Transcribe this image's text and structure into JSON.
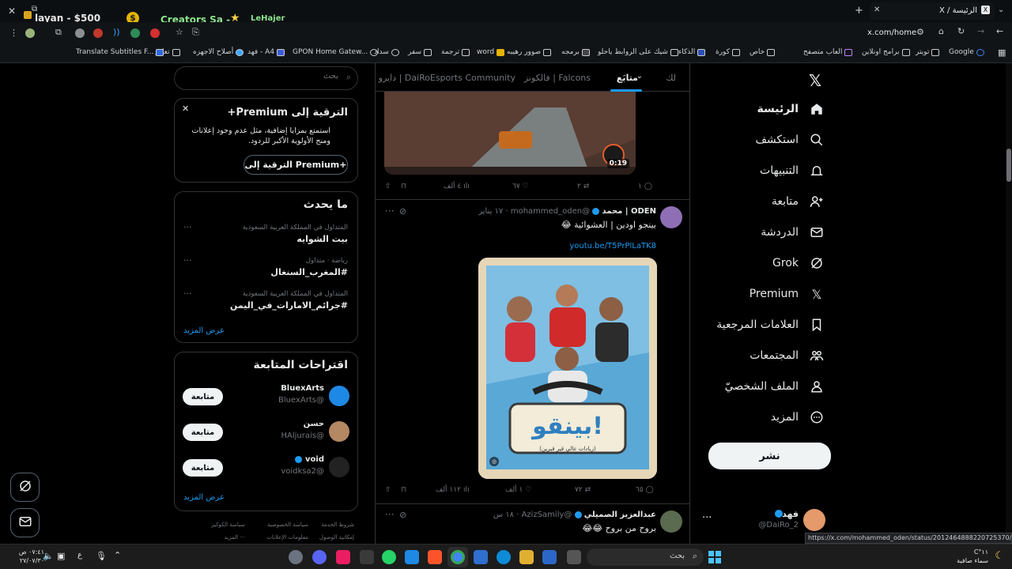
{
  "browser": {
    "tab_title": "الرئيسة / X",
    "tab_left_texts": [
      "layan - $500",
      "Creators Sa -",
      "LeHajer"
    ],
    "url": "x.com/home",
    "bookmarks": [
      "Google",
      "تويتر",
      "برامج اونلاين",
      "العاب متصفح",
      "خاص",
      "كورة",
      "الذكاء",
      "شيك على الروابط ياحلو",
      "برمجه",
      "صوور رهيبه",
      "word",
      "ترجمة",
      "سفر",
      "سداد",
      "GPON Home Gatew...",
      "فهد - A4",
      "أصلاح الاجهزه",
      "تعليم",
      "Translate Subtitles F..."
    ],
    "status_url": "https://x.com/mohammed_oden/status/2012464888220725370/photo/1"
  },
  "nav": {
    "items": [
      {
        "label": "الرئيسة",
        "icon": "home-icon"
      },
      {
        "label": "استكشف",
        "icon": "search-icon"
      },
      {
        "label": "التنبيهات",
        "icon": "bell-icon"
      },
      {
        "label": "متابعة",
        "icon": "add-user-icon"
      },
      {
        "label": "الدردشة",
        "icon": "mail-icon"
      },
      {
        "label": "Grok",
        "icon": "grok-icon"
      },
      {
        "label": "Premium",
        "icon": "x-icon"
      },
      {
        "label": "العلامات المرجعية",
        "icon": "bookmark-icon"
      },
      {
        "label": "المجتمعات",
        "icon": "communities-icon"
      },
      {
        "label": "الملف الشخصيّ",
        "icon": "profile-icon"
      },
      {
        "label": "المزيد",
        "icon": "more-icon"
      }
    ],
    "post_button": "نشر",
    "account": {
      "name": "فهد",
      "handle": "@DaiRo_2"
    }
  },
  "timeline": {
    "tabs": [
      "لك",
      "متابَع",
      "فالكونز | Falcons",
      "Esports Community",
      "دايرو | DaiRo"
    ],
    "tweet1": {
      "video_time": "0:19",
      "replies": "١",
      "retweets": "٢",
      "likes": "٦٧",
      "views": "٤ ألف"
    },
    "tweet2": {
      "name": "ODEN | محمد",
      "handle": "@mohammed_oden",
      "time": "١٧ يناير",
      "text": "بينجو اودين | العشوائية 😂",
      "link": "youtu.be/T5PrPlLaTK8",
      "poster_title": "بينقو!",
      "poster_subtitle": "(زيادات عالي قير قيرين)",
      "replies": "٦٥",
      "retweets": "٧٢",
      "likes": "١ ألف",
      "views": "١١٢ ألف"
    },
    "tweet3": {
      "name": "عبدالعزيز الصميلي",
      "handle": "@AzizSamily",
      "time": "١٨ س",
      "text": "بروح من بروح 😂😂"
    }
  },
  "sidebar": {
    "search_placeholder": "بحث",
    "premium": {
      "title": "الترقية إلى Premium+",
      "body": "استمتع بمزايا إضافية، مثل عدم وجود إعلانات ومنح الأولوية الأكبر للردود.",
      "button": "الترقية إلى Premium+"
    },
    "trends": {
      "title": "ما يحدث",
      "items": [
        {
          "context": "المتداول في المملكة العربية السعودية",
          "name": "بيت الشوايه"
        },
        {
          "context": "رياضة · متداول",
          "name": "#المغرب_السنغال"
        },
        {
          "context": "المتداول في المملكة العربية السعودية",
          "name": "#جرائم_الامارات_في_اليمن"
        }
      ],
      "show_more": "عرض المزيد"
    },
    "follow": {
      "title": "اقتراحات المتابعة",
      "items": [
        {
          "name": "BluexArts",
          "handle": "@BluexArts",
          "button": "متابعة"
        },
        {
          "name": "حسن",
          "handle": "@HAljurais",
          "button": "متابعة"
        },
        {
          "name": "void",
          "handle": "@voidksa2",
          "button": "متابعة"
        }
      ],
      "show_more": "عرض المزيد"
    },
    "footer": [
      "شروط الخدمة",
      "سياسة الخصوصية",
      "سياسة الكوكيز",
      "إمكانية الوصول",
      "معلومات الإعلانات",
      "المزيد ···"
    ]
  },
  "taskbar": {
    "search": "بحث",
    "weather_temp": "١١°C",
    "weather_text": "سماء صافية",
    "time": "٠٧:٤١ ص",
    "date": "٢٧/٠٧/٣٠",
    "lang": "ع"
  },
  "colors": {
    "accent": "#1d9bf0",
    "background": "#000000",
    "border": "#2f3336"
  }
}
